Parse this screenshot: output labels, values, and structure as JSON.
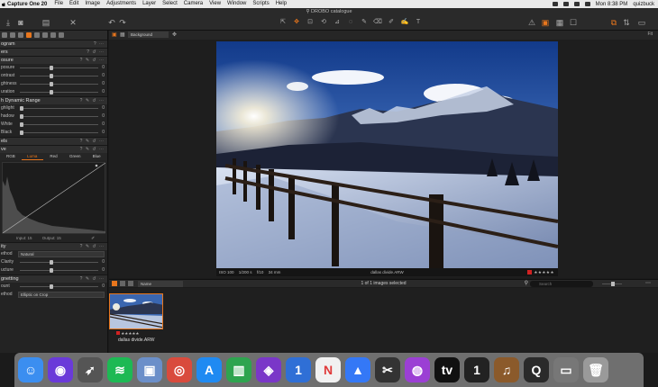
{
  "menubar": {
    "app_name": "Capture One 20",
    "items": [
      "File",
      "Edit",
      "Image",
      "Adjustments",
      "Layer",
      "Select",
      "Camera",
      "View",
      "Window",
      "Scripts",
      "Help"
    ],
    "clock": "Mon 8:38 PM",
    "user": "quizbuck"
  },
  "toolbar": {
    "doc_title": "⚲ DROBO catalogue",
    "zoom": "Fit"
  },
  "left_panel": {
    "histogram_title": "ogram",
    "layers_title": "ers",
    "exposure_title": "osure",
    "exposure_sliders": [
      {
        "label": "posure",
        "value": "0"
      },
      {
        "label": "ontrast",
        "value": "0"
      },
      {
        "label": "ghtness",
        "value": "0"
      },
      {
        "label": "uration",
        "value": "0"
      }
    ],
    "hdr_title": "h Dynamic Range",
    "hdr_sliders": [
      {
        "label": "ghlight",
        "value": "0"
      },
      {
        "label": "hadow",
        "value": "0"
      },
      {
        "label": "White",
        "value": "0"
      },
      {
        "label": "Black",
        "value": "0"
      }
    ],
    "levels_title": "els",
    "curve_title": "ve",
    "curve_tabs": [
      "RGB",
      "Luma",
      "Red",
      "Green",
      "Blue"
    ],
    "curve_input": "Input:  15",
    "curve_output": "Output:  15",
    "clarity_title": "ity",
    "clarity_method_label": "ethod",
    "clarity_method_value": "Natural",
    "clarity_sliders": [
      {
        "label": "Clarity",
        "value": "0"
      },
      {
        "label": "ucture",
        "value": "0"
      }
    ],
    "vignetting_title": "gnetting",
    "vignetting_amount_label": "ount",
    "vignetting_amount_value": "0",
    "vignetting_method_label": "ethod",
    "vignetting_method_value": "Elliptic on Crop"
  },
  "viewer": {
    "background_select": "Background",
    "photo_iso": "ISO 100",
    "photo_shutter": "1/200 s",
    "photo_aperture": "f/10",
    "photo_focal": "34 mm",
    "photo_filename": "dallas divide.ARW",
    "photo_rating": "★★★★★"
  },
  "browser": {
    "sort_select": "Name",
    "count_text": "1 of 1 images selected",
    "search_placeholder": "Search",
    "thumb_rating": "★★★★★",
    "thumb_name": "dallas divide.ARW"
  },
  "dock": {
    "apps": [
      {
        "name": "Finder",
        "glyph": "☺",
        "color": "#3b8ef0"
      },
      {
        "name": "Siri",
        "glyph": "◉",
        "color": "#6a3ad9"
      },
      {
        "name": "Launchpad",
        "glyph": "➶",
        "color": "#555"
      },
      {
        "name": "Spotify",
        "glyph": "≋",
        "color": "#1db954"
      },
      {
        "name": "Preview",
        "glyph": "▣",
        "color": "#6b8fc9"
      },
      {
        "name": "Chrome",
        "glyph": "◎",
        "color": "#d94b3d"
      },
      {
        "name": "App Store",
        "glyph": "A",
        "color": "#1f8af2"
      },
      {
        "name": "Numbers",
        "glyph": "▥",
        "color": "#2ea44f"
      },
      {
        "name": "Affinity Photo",
        "glyph": "◈",
        "color": "#7a37c8"
      },
      {
        "name": "1Password",
        "glyph": "1",
        "color": "#2f6fd6"
      },
      {
        "name": "News",
        "glyph": "N",
        "color": "#f1f1f1"
      },
      {
        "name": "Keynote",
        "glyph": "▲",
        "color": "#3478f6"
      },
      {
        "name": "Final Cut Pro",
        "glyph": "✂",
        "color": "#333"
      },
      {
        "name": "Podcasts",
        "glyph": "◍",
        "color": "#9b3fd4"
      },
      {
        "name": "Apple TV",
        "glyph": "tv",
        "color": "#111"
      },
      {
        "name": "Capture One",
        "glyph": "1",
        "color": "#222"
      },
      {
        "name": "Instruments",
        "glyph": "♫",
        "color": "#8b5a2b"
      },
      {
        "name": "QuickTime",
        "glyph": "Q",
        "color": "#2a2a2a"
      },
      {
        "name": "Screenshot",
        "glyph": "▭",
        "color": "#777"
      },
      {
        "name": "Trash",
        "glyph": "🗑",
        "color": "#9a9a9a"
      }
    ]
  }
}
